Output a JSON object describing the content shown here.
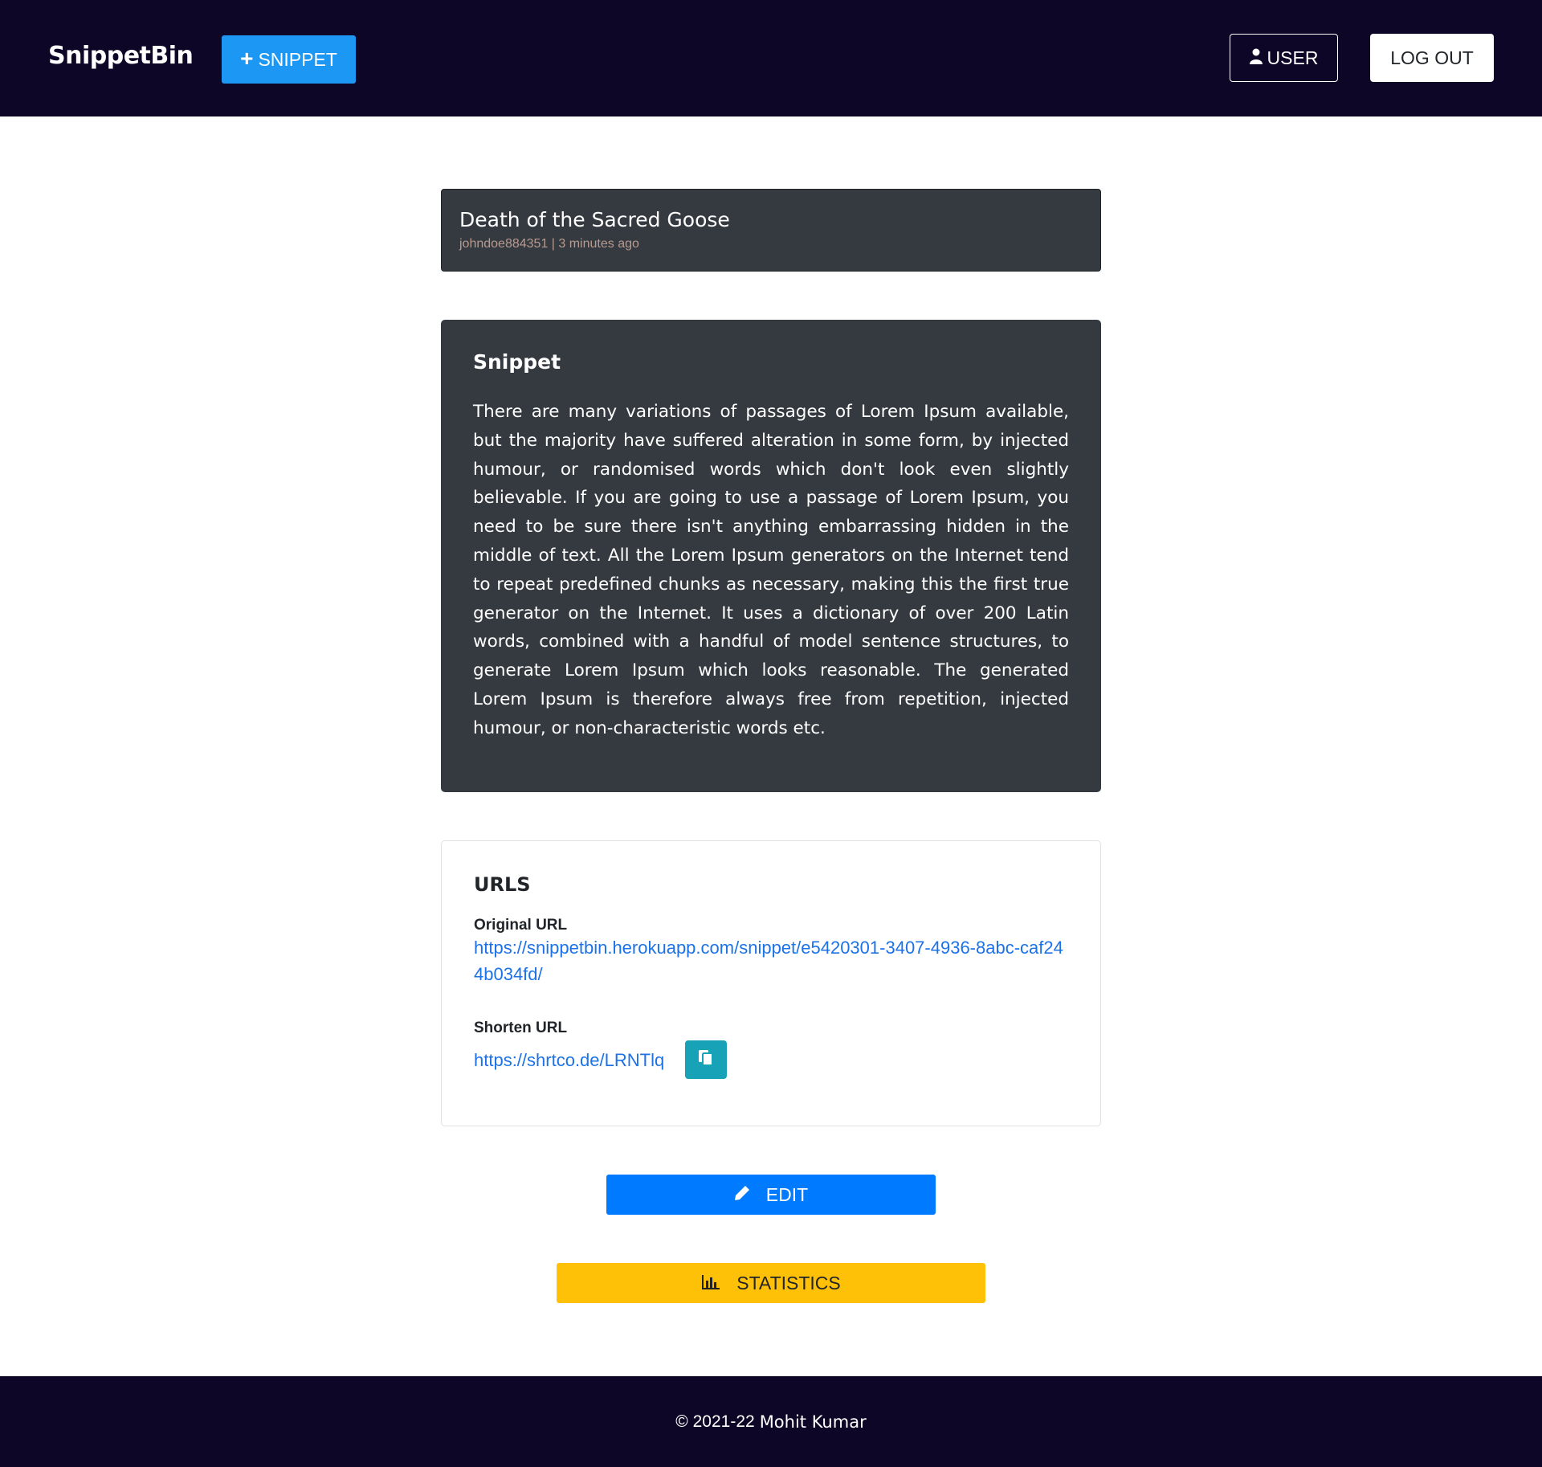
{
  "navbar": {
    "brand": "SnippetBin",
    "new_snippet_label": "SNIPPET",
    "user_label": "USER",
    "logout_label": "LOG OUT"
  },
  "snippet": {
    "title": "Death of the Sacred Goose",
    "meta": "johndoe884351 | 3 minutes ago",
    "heading": "Snippet",
    "content": "There are many variations of passages of Lorem Ipsum available, but the majority have suffered alteration in some form, by injected humour, or randomised words which don't look even slightly believable. If you are going to use a passage of Lorem Ipsum, you need to be sure there isn't anything embarrassing hidden in the middle of text. All the Lorem Ipsum generators on the Internet tend to repeat predefined chunks as necessary, making this the first true generator on the Internet. It uses a dictionary of over 200 Latin words, combined with a handful of model sentence structures, to generate Lorem Ipsum which looks reasonable. The generated Lorem Ipsum is therefore always free from repetition, injected humour, or non-characteristic words etc."
  },
  "urls": {
    "heading": "URLS",
    "original_label": "Original URL",
    "original_url": "https://snippetbin.herokuapp.com/snippet/e5420301-3407-4936-8abc-caf244b034fd/",
    "shorten_label": "Shorten URL",
    "shorten_url": "https://shrtco.de/LRNTlq"
  },
  "actions": {
    "edit_label": "EDIT",
    "statistics_label": "STATISTICS"
  },
  "footer": {
    "copyright": "© 2021-22",
    "author": "Mohit Kumar"
  },
  "colors": {
    "navbar_bg": "#0d0627",
    "card_dark": "#343a40",
    "primary": "#007bff",
    "new_snippet": "#1c97f3",
    "info": "#17a2b8",
    "warning": "#ffc107",
    "link": "#1c72e6"
  }
}
